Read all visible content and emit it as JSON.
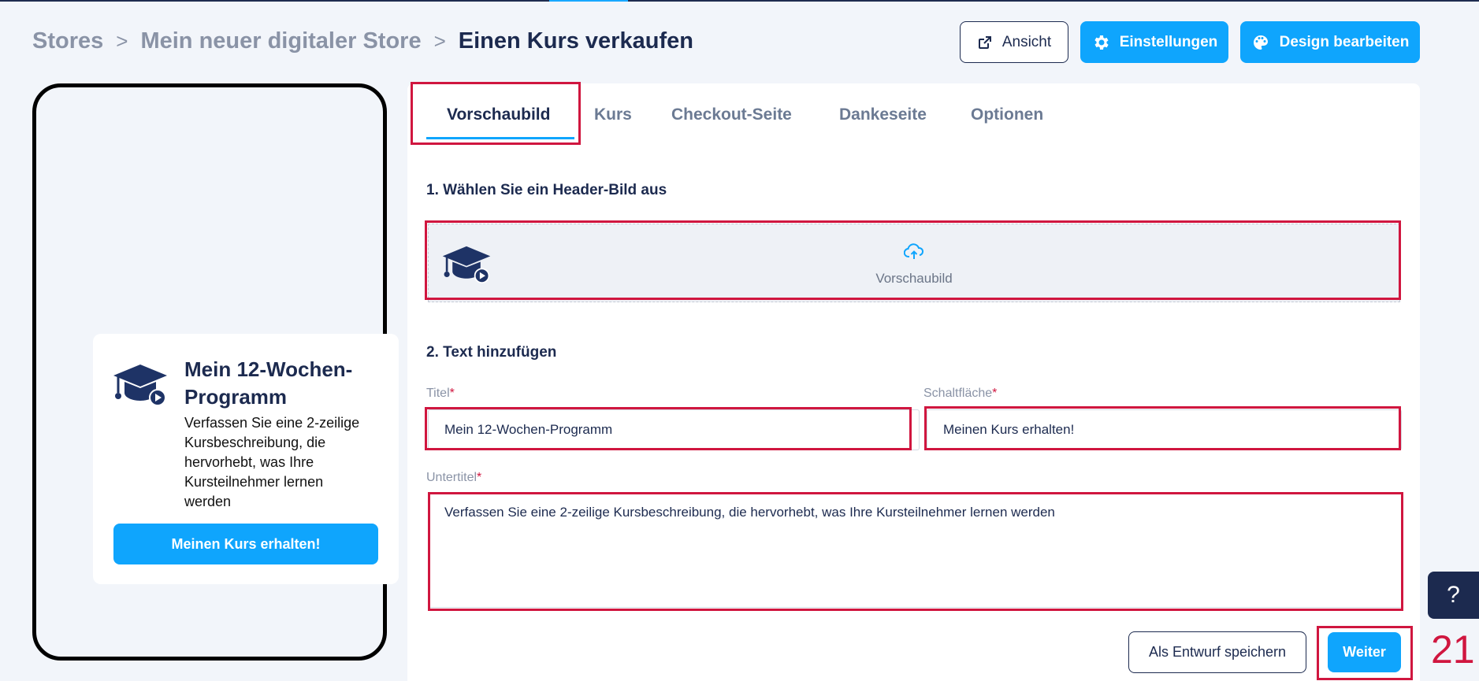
{
  "breadcrumb": {
    "items": [
      "Stores",
      "Mein neuer digitaler Store",
      "Einen Kurs verkaufen"
    ],
    "separator": ">"
  },
  "header_buttons": {
    "view": "Ansicht",
    "settings": "Einstellungen",
    "design": "Design bearbeiten"
  },
  "preview_card": {
    "title": "Mein 12-Wochen-Programm",
    "description": "Verfassen Sie eine 2-zeilige Kursbeschreibung, die hervorhebt, was Ihre Kursteilnehmer lernen werden",
    "button": "Meinen Kurs erhalten!"
  },
  "tabs": [
    {
      "label": "Vorschaubild",
      "active": true
    },
    {
      "label": "Kurs",
      "active": false
    },
    {
      "label": "Checkout-Seite",
      "active": false
    },
    {
      "label": "Dankeseite",
      "active": false
    },
    {
      "label": "Optionen",
      "active": false
    }
  ],
  "section1": {
    "title": "1. Wählen Sie ein Header-Bild aus",
    "upload_label": "Vorschaubild"
  },
  "section2": {
    "title": "2. Text hinzufügen",
    "title_label": "Titel",
    "title_value": "Mein 12-Wochen-Programm",
    "button_label": "Schaltfläche",
    "button_value": "Meinen Kurs erhalten!",
    "subtitle_label": "Untertitel",
    "subtitle_value": "Verfassen Sie eine 2-zeilige Kursbeschreibung, die hervorhebt, was Ihre Kursteilnehmer lernen werden",
    "required_mark": "*"
  },
  "footer_buttons": {
    "draft": "Als Entwurf speichern",
    "next": "Weiter"
  },
  "help": {
    "label": "?"
  },
  "annotation_number": "21",
  "colors": {
    "primary": "#0fa5fd",
    "navy": "#1c2a4f",
    "highlight": "#d0163f"
  },
  "icons": [
    "external-link-icon",
    "gear-icon",
    "palette-icon",
    "graduation-cap-icon",
    "cloud-upload-icon"
  ]
}
